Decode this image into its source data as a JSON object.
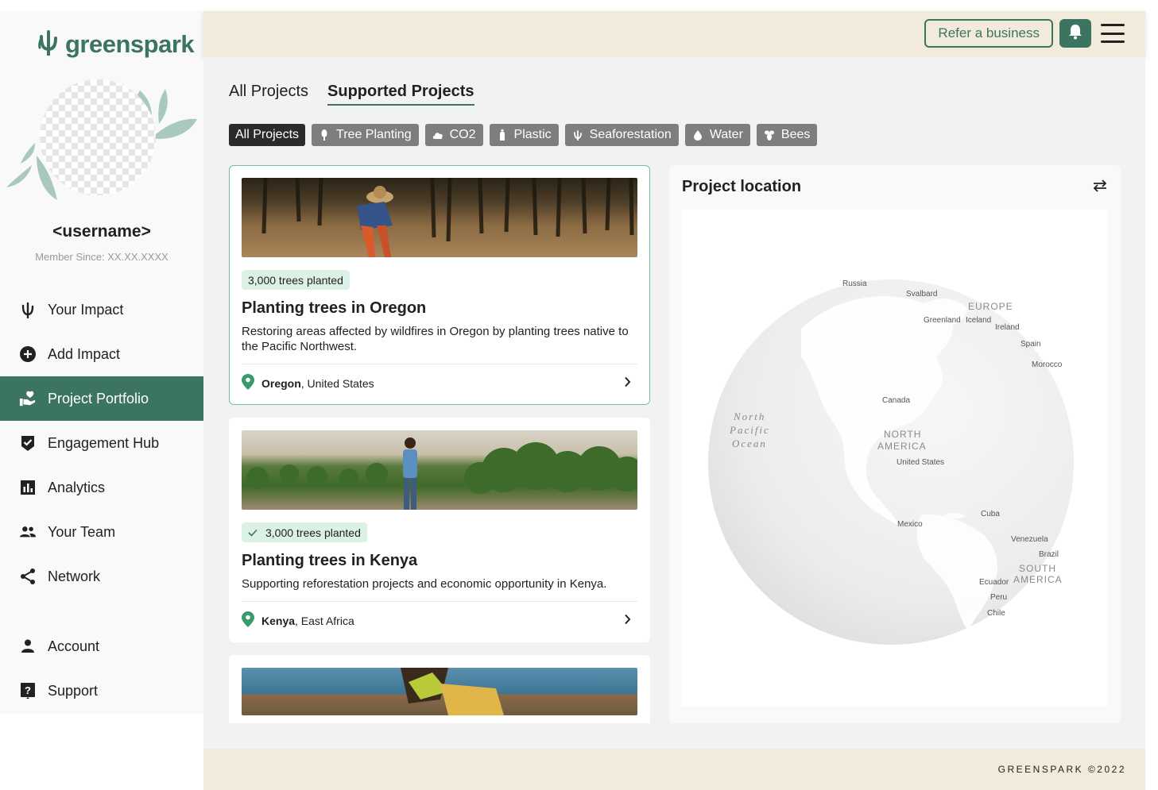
{
  "brand": {
    "name": "greenspark"
  },
  "profile": {
    "username": "<username>",
    "member_since": "Member Since: XX.XX.XXXX"
  },
  "sidebar": {
    "items": [
      {
        "label": "Your Impact",
        "icon": "impact-icon"
      },
      {
        "label": "Add Impact",
        "icon": "add-circle-icon"
      },
      {
        "label": "Project Portfolio",
        "icon": "hand-heart-icon",
        "active": true
      },
      {
        "label": "Engagement Hub",
        "icon": "shield-check-icon"
      },
      {
        "label": "Analytics",
        "icon": "bar-chart-icon"
      },
      {
        "label": "Your Team",
        "icon": "people-icon"
      },
      {
        "label": "Network",
        "icon": "share-icon"
      }
    ],
    "bottom_items": [
      {
        "label": "Account",
        "icon": "person-icon"
      },
      {
        "label": "Support",
        "icon": "help-icon"
      }
    ]
  },
  "header": {
    "refer_label": "Refer a business"
  },
  "tabs": [
    {
      "label": "All Projects"
    },
    {
      "label": "Supported Projects",
      "active": true
    }
  ],
  "filters": [
    {
      "label": "All Projects",
      "active": true
    },
    {
      "label": "Tree Planting",
      "icon": "tree-icon"
    },
    {
      "label": "CO2",
      "icon": "cloud-icon"
    },
    {
      "label": "Plastic",
      "icon": "bottle-icon"
    },
    {
      "label": "Seaforestation",
      "icon": "seaweed-icon"
    },
    {
      "label": "Water",
      "icon": "water-drop-icon"
    },
    {
      "label": "Bees",
      "icon": "bee-icon"
    }
  ],
  "projects": [
    {
      "badge": "3,000 trees planted",
      "title": "Planting trees in Oregon",
      "description": "Restoring areas affected by wildfires in Oregon by planting trees native to the Pacific Northwest.",
      "location_bold": "Oregon",
      "location_rest": ", United States"
    },
    {
      "badge": "3,000 trees planted",
      "title": "Planting trees in Kenya",
      "description": "Supporting reforestation projects and economic opportunity in Kenya.",
      "location_bold": "Kenya",
      "location_rest": ", East Africa"
    }
  ],
  "location_panel": {
    "title": "Project location",
    "map_labels": {
      "russia": "Russia",
      "svalbard": "Svalbard",
      "europe": "EUROPE",
      "greenland": "Greenland",
      "iceland": "Iceland",
      "ireland": "Ireland",
      "spain": "Spain",
      "morocco": "Morocco",
      "canada": "Canada",
      "north_america_1": "NORTH",
      "north_america_2": "AMERICA",
      "united_states": "United States",
      "npo_1": "North",
      "npo_2": "Pacific",
      "npo_3": "Ocean",
      "mexico": "Mexico",
      "cuba": "Cuba",
      "venezuela": "Venezuela",
      "brazil": "Brazil",
      "south_america_1": "SOUTH",
      "south_america_2": "AMERICA",
      "ecuador": "Ecuador",
      "peru": "Peru",
      "chile": "Chile"
    }
  },
  "footer": {
    "copyright": "GREENSPARK ©2022"
  },
  "colors": {
    "brand_green": "#3b755f",
    "header_bg": "#f2ebdb",
    "badge_bg": "#dbf1e6",
    "chip_bg": "#7e7e7e",
    "chip_active_bg": "#2b2b2b"
  }
}
